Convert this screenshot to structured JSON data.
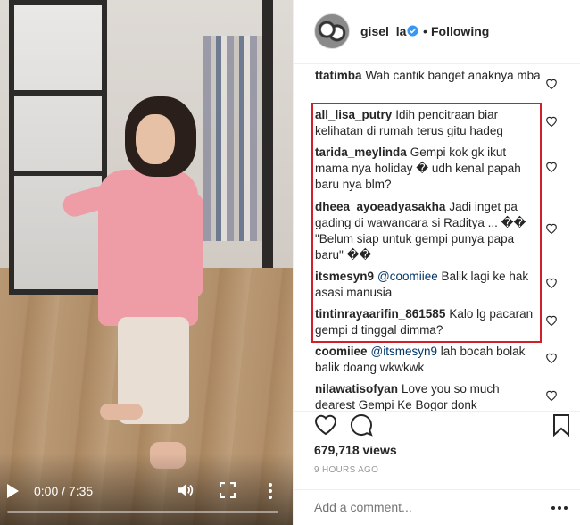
{
  "video": {
    "time": "0:00 / 7:35",
    "progress": 0
  },
  "post": {
    "username": "gisel_la",
    "follow_state": "Following",
    "views": "679,718 views",
    "age": "9 HOURS AGO",
    "add_comment_placeholder": "Add a comment..."
  },
  "comments": [
    {
      "user": "ttatimba",
      "text": "Wah cantik banget anaknya mba"
    },
    {
      "user": "all_lisa_putry",
      "text": "Idih pencitraan biar kelihatan di rumah terus gitu hadeg"
    },
    {
      "user": "tarida_meylinda",
      "text": "Gempi kok gk ikut mama nya holiday � udh kenal papah baru nya blm?"
    },
    {
      "user": "dheea_ayoeadyasakha",
      "text": "Jadi inget pa gading di wawancara si Raditya ... �� \"Belum siap untuk gempi punya papa baru\" ��"
    },
    {
      "user": "itsmesyn9",
      "mention": "@coomiiee",
      "text": "Balik lagi ke hak asasi manusia"
    },
    {
      "user": "tintinrayaarifin_861585",
      "text": "Kalo lg pacaran gempi d tinggal dimma?"
    },
    {
      "user": "coomiiee",
      "mention": "@itsmesyn9",
      "text": "lah bocah bolak balik doang wkwkwk"
    },
    {
      "user": "nilawatisofyan",
      "text": "Love you so much dearest Gempi Ke Bogor donk"
    }
  ],
  "colors": {
    "highlight": "#d0202a",
    "verified": "#3897f0",
    "mention": "#003569"
  }
}
